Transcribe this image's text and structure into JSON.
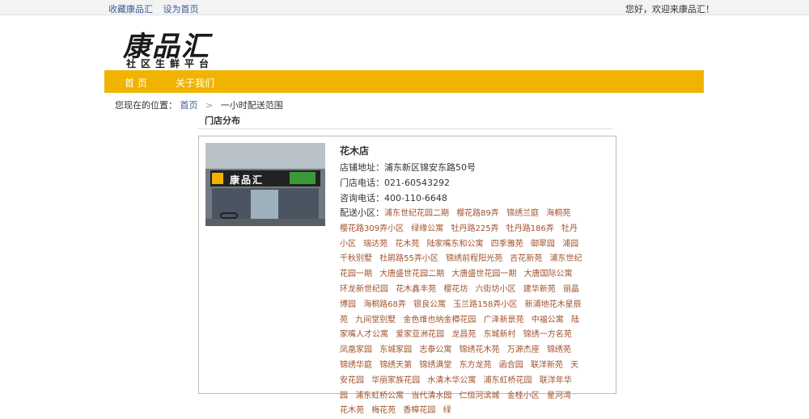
{
  "topbar": {
    "links": [
      "收藏康品汇",
      "设为首页"
    ],
    "welcome": "您好，欢迎来康品汇！"
  },
  "logo": {
    "main": "康品汇",
    "sub": "社区生鲜平台"
  },
  "nav": {
    "items": [
      "首 页",
      "关于我们"
    ],
    "color": "#f0b400"
  },
  "breadcrumb": {
    "prefix": "您现在的位置：",
    "home": "首页",
    "current": "一小时配送范围"
  },
  "section": {
    "title": "门店分布"
  },
  "store": {
    "photo_sign": "康品汇",
    "name": "花木店",
    "address": "店铺地址：浦东新区锦安东路50号",
    "phone": "门店电话：021-60543292",
    "hotline": "咨询电话：400-110-6648",
    "areas_label": "配送小区：",
    "areas": [
      "浦东世纪花园二期",
      "樱花路89弄",
      "锦绣兰庭",
      "海桐苑",
      "樱花路309弄小区",
      "绿缘公寓",
      "牡丹路225弄",
      "牡丹路186弄",
      "牡丹小区",
      "瑞达苑",
      "花木苑",
      "陆家嘴东和公寓",
      "四季雅苑",
      "御翠园",
      "浦园千秋别墅",
      "杜鹃路55弄小区",
      "锦绣前程阳光苑",
      "吉花新苑",
      "浦东世纪花园一期",
      "大唐盛世花园二期",
      "大唐盛世花园一期",
      "大唐国际公寓",
      "环龙新世纪园",
      "花木鑫丰苑",
      "樱花坊",
      "六街坊小区",
      "建华新苑",
      "丽晶博园",
      "海桐路68弄",
      "银良公寓",
      "玉兰路158弄小区",
      "新浦地花木星辰苑",
      "九间堂别墅",
      "金色维也纳金樽花园",
      "广泽新景苑",
      "中福公寓",
      "陆家嘴人才公寓",
      "爱家亚洲花园",
      "龙昌苑",
      "东城新村",
      "锦绣一方名苑",
      "凤凰家园",
      "东城家园",
      "志泰公寓",
      "锦绣花木苑",
      "万源杰座",
      "锦绣苑",
      "锦绣华庭",
      "锦绣天第",
      "锦绣满堂",
      "东方龙苑",
      "函合园",
      "联洋新苑",
      "天安花园",
      "华丽家族花园",
      "水清木华公寓",
      "浦东虹桥花园",
      "联洋年华园",
      "浦东虹桥公寓",
      "当代清水园",
      "仁恒河滨城",
      "金桂小区",
      "星河湾",
      "花木苑",
      "梅花苑",
      "香樟花园",
      "绿"
    ]
  }
}
